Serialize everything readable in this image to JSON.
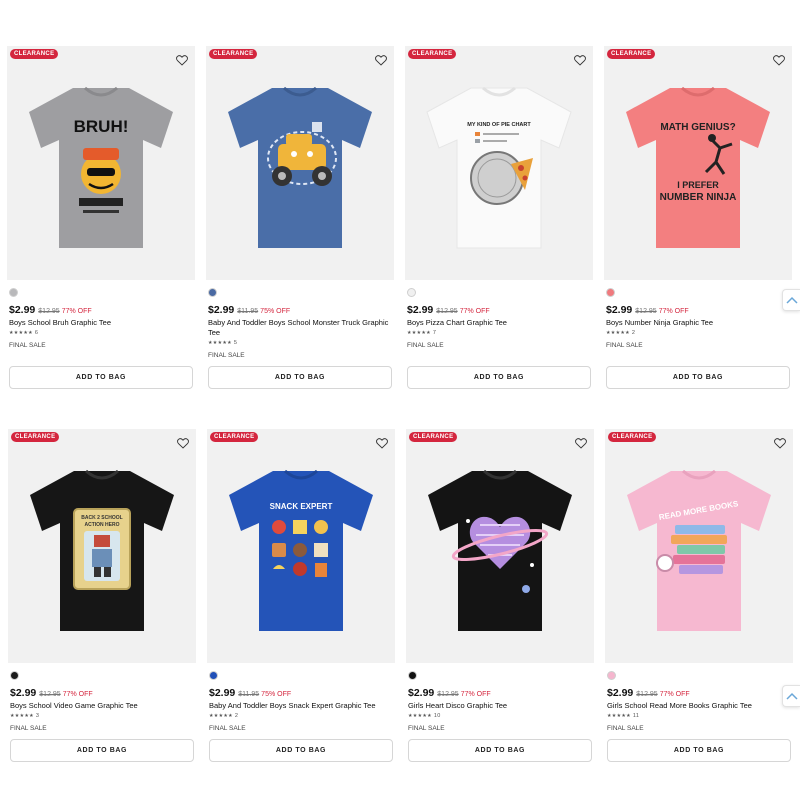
{
  "badge_label": "CLEARANCE",
  "add_to_bag_label": "ADD TO BAG",
  "final_sale_label": "FINAL SALE",
  "star_glyphs": "★★★★★",
  "products": [
    {
      "name": "Boys School Bruh Graphic Tee",
      "price": "$2.99",
      "original_price": "$12.95",
      "discount": "77% OFF",
      "review_count": "6",
      "swatch_color": "#b9b9bb",
      "shirt_color": "#9e9ea1",
      "graphic_text": "BRUH!"
    },
    {
      "name": "Baby And Toddler Boys School Monster Truck Graphic Tee",
      "price": "$2.99",
      "original_price": "$11.95",
      "discount": "75% OFF",
      "review_count": "5",
      "swatch_color": "#4a6aa3",
      "shirt_color": "#4a6ea8",
      "graphic_text": ""
    },
    {
      "name": "Boys Pizza Chart Graphic Tee",
      "price": "$2.99",
      "original_price": "$12.95",
      "discount": "77% OFF",
      "review_count": "7",
      "swatch_color": "#f0f0f0",
      "shirt_color": "#fafafa",
      "graphic_text": "MY KIND OF PIE CHART"
    },
    {
      "name": "Boys Number Ninja Graphic Tee",
      "price": "$2.99",
      "original_price": "$12.95",
      "discount": "77% OFF",
      "review_count": "2",
      "swatch_color": "#f07a7e",
      "shirt_color": "#f37f80",
      "graphic_text": "MATH GENIUS? I PREFER NUMBER NINJA"
    },
    {
      "name": "Boys School Video Game Graphic Tee",
      "price": "$2.99",
      "original_price": "$12.95",
      "discount": "77% OFF",
      "review_count": "3",
      "swatch_color": "#1a1a1a",
      "shirt_color": "#161616",
      "graphic_text": "BACK 2 SCHOOL ACTION HERO"
    },
    {
      "name": "Baby And Toddler Boys Snack Expert Graphic Tee",
      "price": "$2.99",
      "original_price": "$11.95",
      "discount": "75% OFF",
      "review_count": "2",
      "swatch_color": "#2150b8",
      "shirt_color": "#2454b8",
      "graphic_text": "SNACK EXPERT"
    },
    {
      "name": "Girls Heart Disco Graphic Tee",
      "price": "$2.99",
      "original_price": "$12.95",
      "discount": "77% OFF",
      "review_count": "10",
      "swatch_color": "#111111",
      "shirt_color": "#141414",
      "graphic_text": ""
    },
    {
      "name": "Girls School Read More Books Graphic Tee",
      "price": "$2.99",
      "original_price": "$12.95",
      "discount": "77% OFF",
      "review_count": "11",
      "swatch_color": "#f5b6ce",
      "shirt_color": "#f6b8d0",
      "graphic_text": "READ MORE BOOKS"
    }
  ],
  "colors": {
    "sale_red": "#d4263e",
    "image_bg": "#f1f1f1"
  },
  "icons": {
    "wishlist": "heart-outline-icon",
    "scroll_top": "chevron-up-icon"
  }
}
